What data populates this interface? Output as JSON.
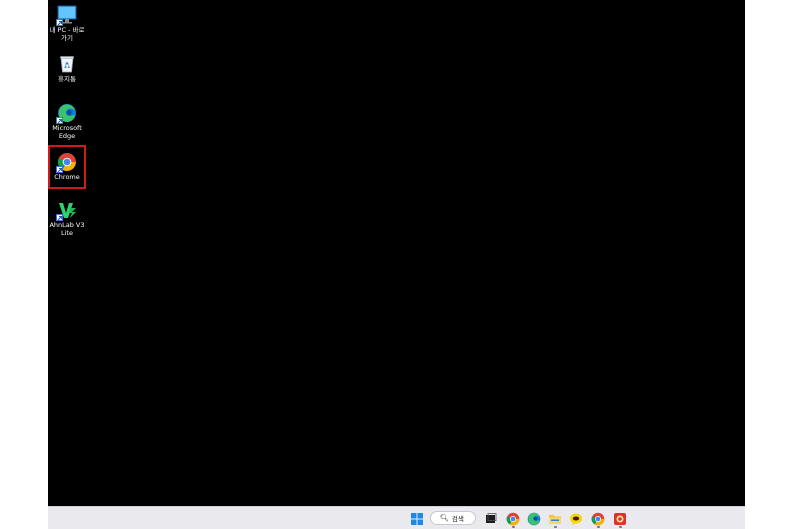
{
  "desktop": {
    "icons": [
      {
        "label_line1": "내 PC - 바로",
        "label_line2": "가기",
        "icon": "my-pc-shortcut-icon"
      },
      {
        "label_line1": "휴지통",
        "label_line2": "",
        "icon": "recycle-bin-icon"
      },
      {
        "label_line1": "Microsoft",
        "label_line2": "Edge",
        "icon": "edge-icon"
      },
      {
        "label_line1": "Chrome",
        "label_line2": "",
        "icon": "chrome-icon"
      },
      {
        "label_line1": "AhnLab V3",
        "label_line2": "Lite",
        "icon": "ahnlab-v3-icon"
      }
    ],
    "highlighted_icon": "Chrome",
    "highlight_color": "#d11a1a",
    "background": "#000000"
  },
  "taskbar": {
    "search_label": "검색",
    "apps": [
      "start-icon",
      "search",
      "task-view-icon",
      "chrome-taskbar-icon",
      "edge-taskbar-icon",
      "file-explorer-icon",
      "kakaotalk-icon",
      "chrome-taskbar-icon-2",
      "red-app-icon"
    ]
  }
}
